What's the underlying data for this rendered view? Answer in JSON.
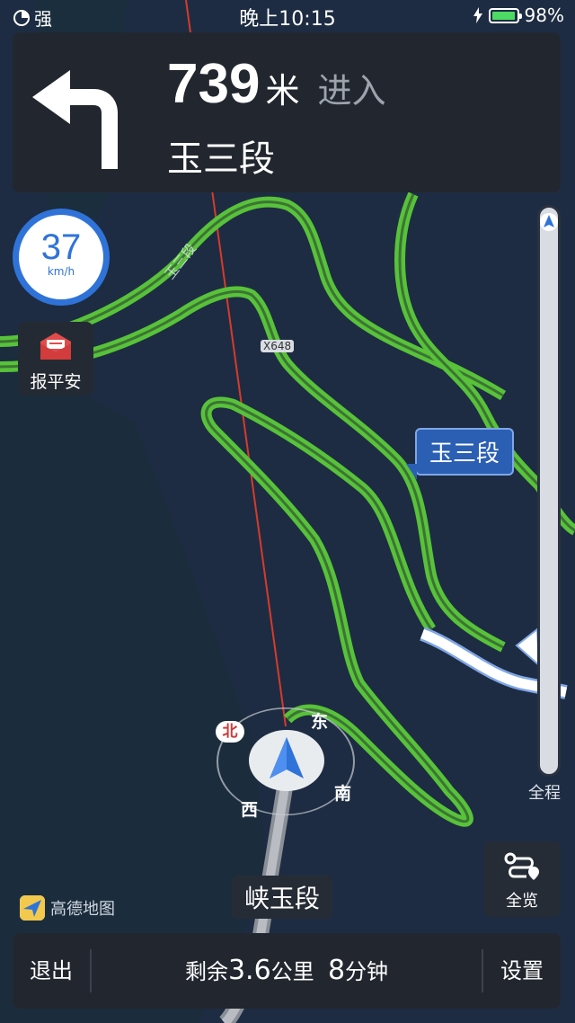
{
  "status_bar": {
    "signal_text": "强",
    "time": "晚上10:15",
    "battery_percent_text": "98%",
    "battery_level": 0.98
  },
  "guidance": {
    "turn_icon": "turn-left-icon",
    "distance": "739",
    "distance_unit": "米",
    "action": "进入",
    "next_road": "玉三段"
  },
  "speed": {
    "value": "37",
    "unit": "km/h"
  },
  "report_safe": {
    "label": "报平安",
    "icon": "envelope-icon"
  },
  "map": {
    "road_labels": [
      "玉三段",
      "X648"
    ],
    "callout": "玉三段",
    "current_road": "峡玉段",
    "compass": {
      "north": "北",
      "east": "东",
      "south": "南",
      "west": "西"
    }
  },
  "progress": {
    "label": "全程"
  },
  "overview": {
    "label": "全览",
    "icon": "route-overview-icon"
  },
  "logo": {
    "text": "高德地图"
  },
  "bottom_bar": {
    "exit_label": "退出",
    "remain_prefix": "剩余",
    "remain_distance": "3.6",
    "remain_distance_unit": "公里",
    "remain_time": "8",
    "remain_time_unit": "分钟",
    "settings_label": "设置"
  },
  "colors": {
    "route_green": "#58c23a",
    "panel_bg": "#22272f",
    "accent_blue": "#2f73d9",
    "map_bg": "#1b2a3e"
  }
}
